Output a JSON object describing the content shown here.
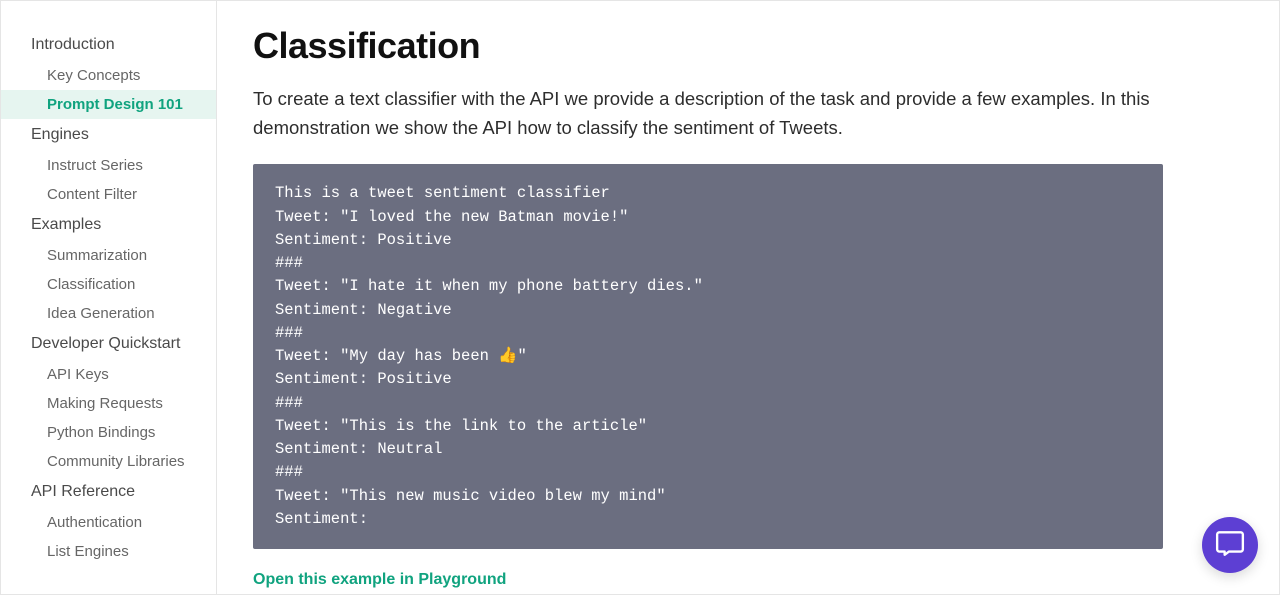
{
  "sidebar": {
    "sections": [
      {
        "title": "Introduction",
        "items": [
          {
            "label": "Key Concepts",
            "active": false
          },
          {
            "label": "Prompt Design 101",
            "active": true
          }
        ]
      },
      {
        "title": "Engines",
        "items": [
          {
            "label": "Instruct Series",
            "active": false
          },
          {
            "label": "Content Filter",
            "active": false
          }
        ]
      },
      {
        "title": "Examples",
        "items": [
          {
            "label": "Summarization",
            "active": false
          },
          {
            "label": "Classification",
            "active": false
          },
          {
            "label": "Idea Generation",
            "active": false
          }
        ]
      },
      {
        "title": "Developer Quickstart",
        "items": [
          {
            "label": "API Keys",
            "active": false
          },
          {
            "label": "Making Requests",
            "active": false
          },
          {
            "label": "Python Bindings",
            "active": false
          },
          {
            "label": "Community Libraries",
            "active": false
          }
        ]
      },
      {
        "title": "API Reference",
        "items": [
          {
            "label": "Authentication",
            "active": false
          },
          {
            "label": "List Engines",
            "active": false
          }
        ]
      }
    ]
  },
  "main": {
    "title": "Classification",
    "intro": "To create a text classifier with the API we provide a description of the task and provide a few examples. In this demonstration we show the API how to classify the sentiment of Tweets.",
    "code": "This is a tweet sentiment classifier\nTweet: \"I loved the new Batman movie!\"\nSentiment: Positive\n###\nTweet: \"I hate it when my phone battery dies.\"\nSentiment: Negative\n###\nTweet: \"My day has been 👍\"\nSentiment: Positive\n###\nTweet: \"This is the link to the article\"\nSentiment: Neutral\n###\nTweet: \"This new music video blew my mind\"\nSentiment:",
    "playground_link": "Open this example in Playground"
  }
}
